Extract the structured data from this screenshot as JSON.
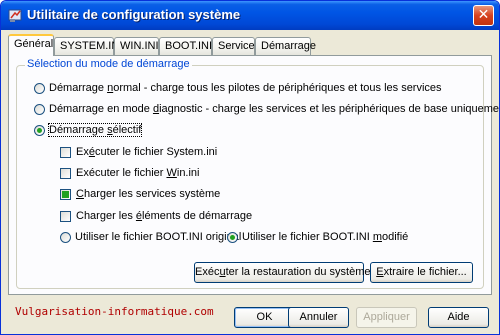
{
  "window": {
    "title": "Utilitaire de configuration système",
    "close_symbol": "✕"
  },
  "tabs": [
    {
      "label": "Général",
      "active": true
    },
    {
      "label": "SYSTEM.INI",
      "active": false
    },
    {
      "label": "WIN.INI",
      "active": false
    },
    {
      "label": "BOOT.INI",
      "active": false
    },
    {
      "label": "Services",
      "active": false
    },
    {
      "label": "Démarrage",
      "active": false
    }
  ],
  "startup_group": {
    "legend": "Sélection du mode de démarrage",
    "normal": {
      "pre": "Démarrage ",
      "key": "n",
      "post": "ormal - charge tous les pilotes de périphériques et tous les services",
      "checked": false
    },
    "diagnostic": {
      "pre": "Démarrage en mode ",
      "key": "d",
      "post": "iagnostic - charge les services et les périphériques de base uniquement",
      "checked": false
    },
    "selective": {
      "pre": "Démarrage ",
      "key": "s",
      "post": "électif",
      "checked": true
    },
    "options": [
      {
        "pre": "Ex",
        "key": "é",
        "post": "cuter le fichier System.ini",
        "state": "unchecked"
      },
      {
        "pre": "Exécuter le fichier ",
        "key": "W",
        "post": "in.ini",
        "state": "unchecked"
      },
      {
        "pre": "",
        "key": "C",
        "post": "harger les services système",
        "state": "mixed"
      },
      {
        "pre": "Charger les ",
        "key": "é",
        "post": "léments de démarrage",
        "state": "unchecked"
      }
    ],
    "boot_original": {
      "label": "Utiliser le fichier BOOT.INI original",
      "checked": false
    },
    "boot_modified": {
      "pre": "Utiliser le fichier BOOT.INI ",
      "key": "m",
      "post": "odifié",
      "checked": true
    },
    "restore_button": {
      "pre": "Exéc",
      "key": "u",
      "post": "ter la restauration du système"
    },
    "extract_button": {
      "pre": "",
      "key": "E",
      "post": "xtraire le fichier..."
    }
  },
  "watermark": "Vulgarisation-informatique.com",
  "buttons": {
    "ok": "OK",
    "cancel": "Annuler",
    "apply": "Appliquer",
    "help": "Aide"
  },
  "colors": {
    "title_bar": "#0055e5",
    "legend_text": "#0046d5",
    "watermark": "#b00000",
    "check_fill": "#21a121"
  },
  "icons": {
    "title": "msconfig-icon",
    "close": "close-icon"
  }
}
